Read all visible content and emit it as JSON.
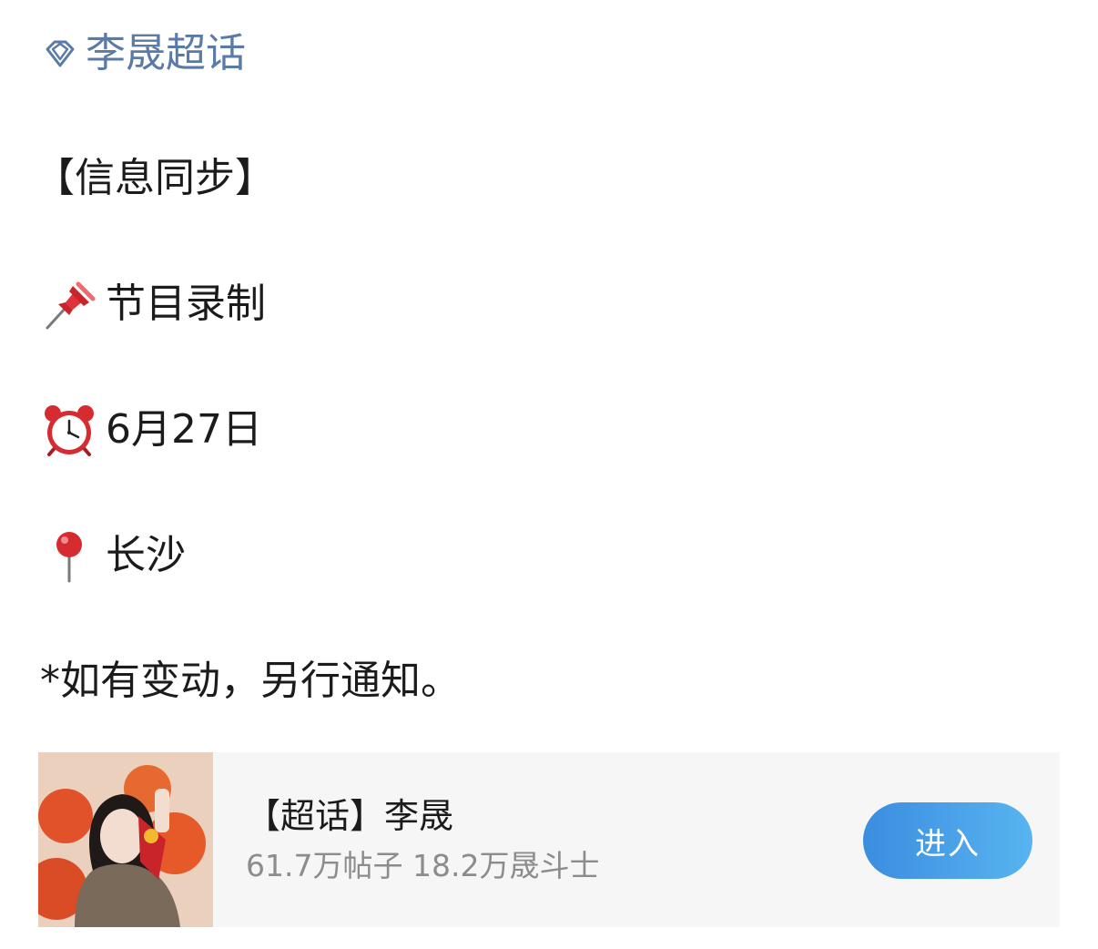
{
  "topic_link": {
    "icon": "diamond-icon",
    "label": "李晟超话"
  },
  "post": {
    "heading": "【信息同步】",
    "lines": [
      {
        "icon": "pushpin-icon",
        "text": "节目录制"
      },
      {
        "icon": "alarm-clock-icon",
        "text": "6月27日"
      },
      {
        "icon": "round-pin-icon",
        "text": "长沙"
      }
    ],
    "note": "*如有变动，另行通知。"
  },
  "supertopic_card": {
    "title": "【超话】李晟",
    "stats": "61.7万帖子 18.2万晟斗士",
    "button_label": "进入",
    "accent_color": "#3b8de0"
  },
  "colors": {
    "link": "#5a7aa8",
    "text": "#1b1b1b",
    "muted": "#8c8c8c",
    "card_bg": "#f6f6f6"
  }
}
